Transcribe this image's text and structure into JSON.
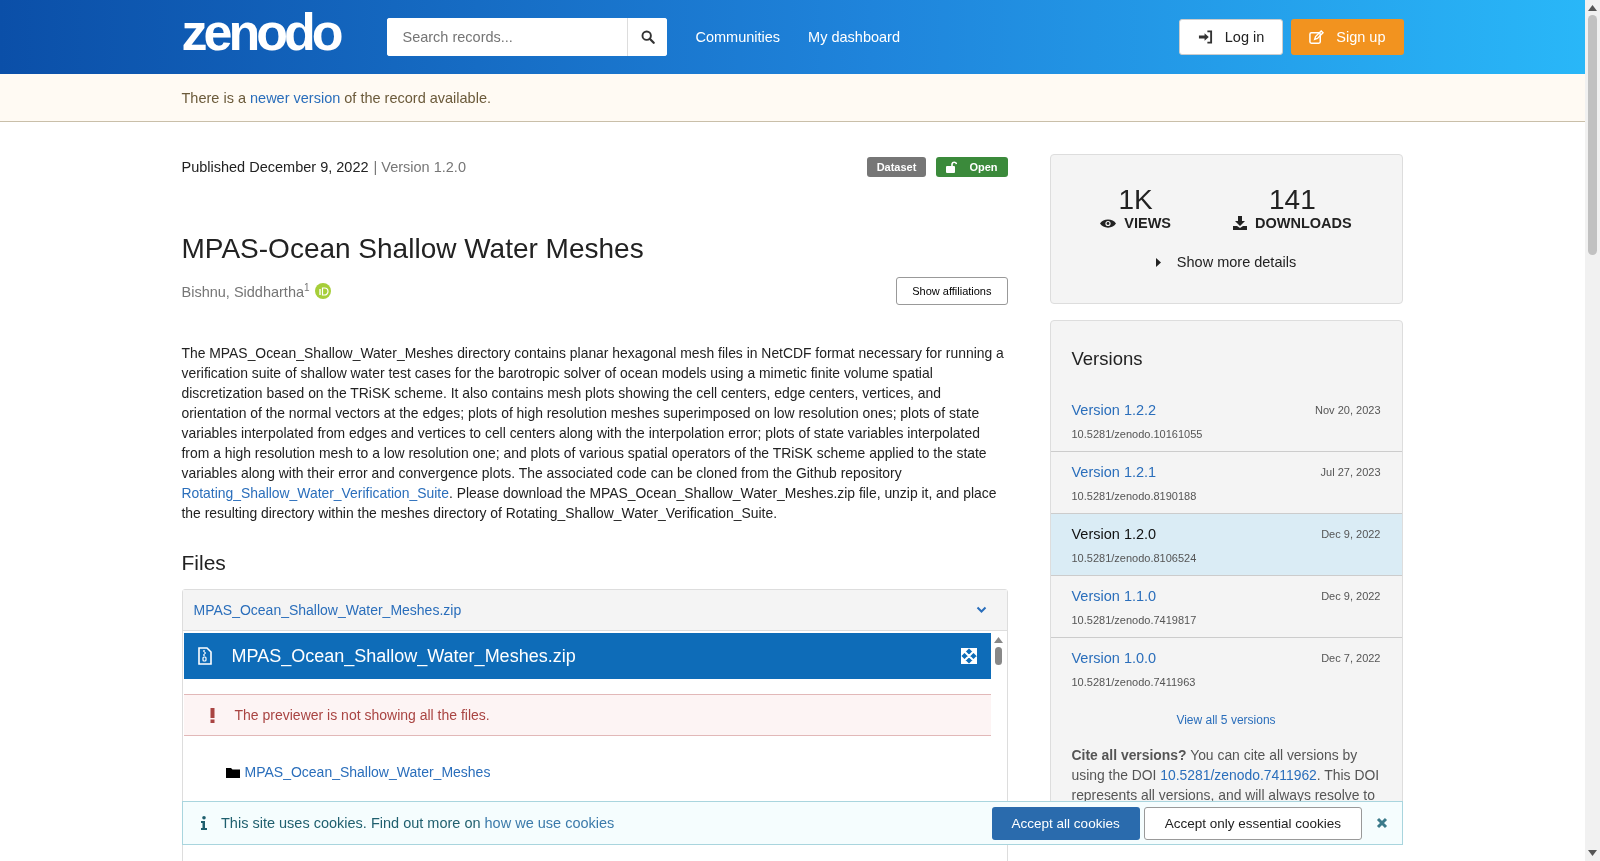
{
  "header": {
    "logo": "zenodo",
    "search": {
      "placeholder": "Search records..."
    },
    "nav": [
      "Communities",
      "My dashboard"
    ],
    "login": "Log in",
    "signup": "Sign up"
  },
  "notice": {
    "before": "There is a",
    "link": "newer version",
    "after": "of the record available."
  },
  "record": {
    "published": "Published December 9, 2022",
    "version": "| Version 1.2.0",
    "badges": [
      {
        "kind": "type",
        "label": "Dataset"
      },
      {
        "kind": "access",
        "label": "Open"
      }
    ],
    "title": "MPAS-Ocean Shallow Water Meshes",
    "author": "Bishnu, Siddhartha",
    "author_mark": "1",
    "show_affiliations": "Show affiliations",
    "description_before": "The MPAS_Ocean_Shallow_Water_Meshes directory contains planar hexagonal mesh files in NetCDF format necessary for running a verification suite of shallow water test cases for the barotropic solver of ocean models using a mimetic finite volume spatial discretization based on the TRiSK scheme. It also contains mesh plots showing the cell centers, edge centers, vertices, and orientation of the normal vectors at the edges; plots of high resolution meshes superimposed on low resolution ones; plots of state variables interpolated from edges and vertices to cell centers along with the interpolation error; plots of state variables interpolated from a high resolution mesh to a low resolution one; and plots of various spatial operators of the TRiSK scheme applied to the state variables along with their error and convergence plots. The associated code can be cloned from the Github repository",
    "description_link": "Rotating_Shallow_Water_Verification_Suite",
    "description_after": ". Please download the MPAS_Ocean_Shallow_Water_Meshes.zip file, unzip it, and place the resulting directory within the meshes directory of Rotating_Shallow_Water_Verification_Suite."
  },
  "files": {
    "heading": "Files",
    "accordion_title": "MPAS_Ocean_Shallow_Water_Meshes.zip",
    "preview_title": "MPAS_Ocean_Shallow_Water_Meshes.zip",
    "warning": "The previewer is not showing all the files.",
    "tree": [
      {
        "name": "MPAS_Ocean_Shallow_Water_Meshes"
      }
    ]
  },
  "stats": {
    "views": "1K",
    "views_label": "VIEWS",
    "downloads": "141",
    "downloads_label": "DOWNLOADS",
    "more": "Show more details"
  },
  "versions": {
    "heading": "Versions",
    "items": [
      {
        "label": "Version 1.2.2",
        "date": "Nov 20, 2023",
        "doi": "10.5281/zenodo.10161055",
        "selected": false
      },
      {
        "label": "Version 1.2.1",
        "date": "Jul 27, 2023",
        "doi": "10.5281/zenodo.8190188",
        "selected": false
      },
      {
        "label": "Version 1.2.0",
        "date": "Dec 9, 2022",
        "doi": "10.5281/zenodo.8106524",
        "selected": true
      },
      {
        "label": "Version 1.1.0",
        "date": "Dec 9, 2022",
        "doi": "10.5281/zenodo.7419817",
        "selected": false
      },
      {
        "label": "Version 1.0.0",
        "date": "Dec 7, 2022",
        "doi": "10.5281/zenodo.7411963",
        "selected": false
      }
    ],
    "view_all": "View all 5 versions",
    "cite_lead": "Cite all versions?",
    "cite_before": "You can cite all versions by using the DOI",
    "cite_link": "10.5281/zenodo.7411962",
    "cite_after": ". This DOI represents all versions, and will always resolve to"
  },
  "cookies": {
    "text": "This site uses cookies. Find out more on",
    "link": "how we use cookies",
    "accept_all": "Accept all cookies",
    "accept_essential": "Accept only essential cookies"
  }
}
